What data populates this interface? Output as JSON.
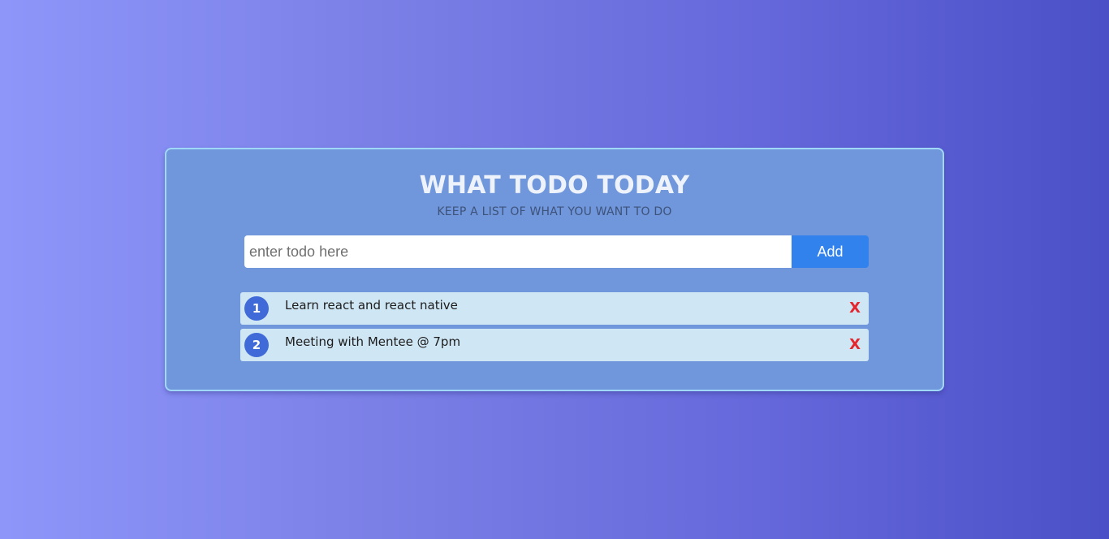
{
  "colors": {
    "card_background": "#7097dc",
    "card_border": "#9fd9f7",
    "add_button": "#3282ee",
    "item_background": "#cfe6f4",
    "number_badge": "#3f6ad8",
    "delete_x": "#e4262e"
  },
  "header": {
    "title": "WHAT TODO TODAY",
    "subtitle": "KEEP A LIST OF WHAT YOU WANT TO DO"
  },
  "form": {
    "placeholder": "enter todo here",
    "value": "",
    "add_label": "Add"
  },
  "todos": [
    {
      "number": "1",
      "text": "Learn react and react native",
      "delete_label": "X"
    },
    {
      "number": "2",
      "text": "Meeting with Mentee @ 7pm",
      "delete_label": "X"
    }
  ]
}
